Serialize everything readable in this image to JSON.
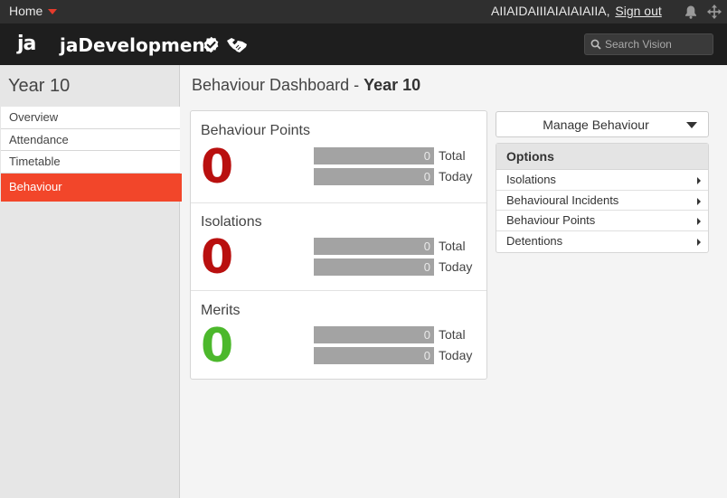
{
  "topbar": {
    "home_label": "Home",
    "user_name": "AIIAIDAIIIAIAIAIAIIA,",
    "sign_out_label": "Sign out",
    "icons": [
      "bell-icon",
      "move-icon"
    ]
  },
  "header": {
    "logo_text": "ja",
    "app_name": "jaDevelopment",
    "icons": [
      "verified-icon",
      "handshake-icon"
    ],
    "search_placeholder": "Search Vision"
  },
  "sidebar": {
    "title": "Year 10",
    "items": [
      {
        "label": "Overview",
        "active": false
      },
      {
        "label": "Attendance",
        "active": false
      },
      {
        "label": "Timetable",
        "active": false
      },
      {
        "label": "Behaviour",
        "active": true
      }
    ]
  },
  "main": {
    "title_prefix": "Behaviour Dashboard - ",
    "title_bold": "Year 10",
    "stats": [
      {
        "label": "Behaviour Points",
        "value": "0",
        "color": "#b9100f",
        "total": "0",
        "today": "0"
      },
      {
        "label": "Isolations",
        "value": "0",
        "color": "#b9100f",
        "total": "0",
        "today": "0"
      },
      {
        "label": "Merits",
        "value": "0",
        "color": "#4cb82c",
        "total": "0",
        "today": "0"
      }
    ],
    "total_label": "Total",
    "today_label": "Today"
  },
  "panel": {
    "manage_label": "Manage Behaviour",
    "options_title": "Options",
    "options": [
      "Isolations",
      "Behavioural Incidents",
      "Behaviour Points",
      "Detentions"
    ]
  }
}
